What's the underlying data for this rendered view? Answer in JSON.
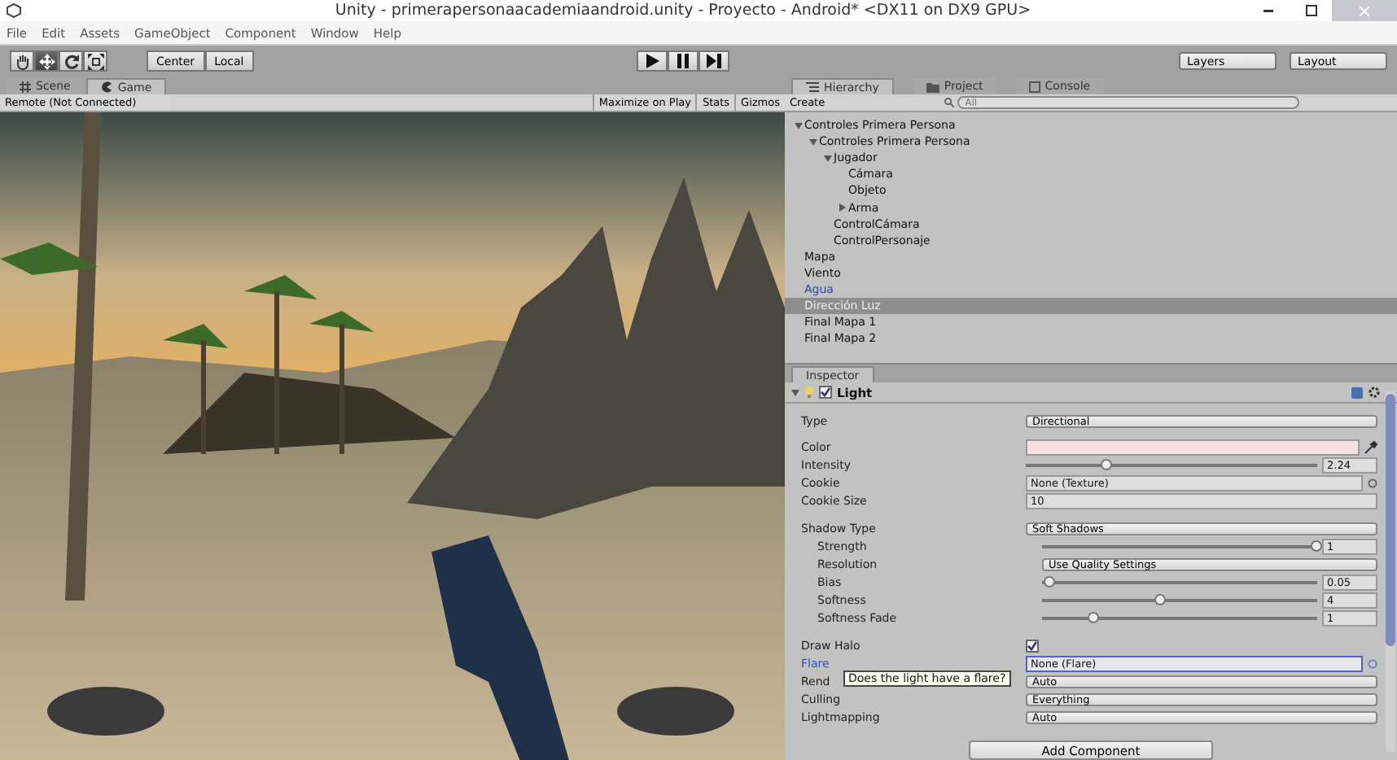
{
  "window": {
    "title": "Unity - primerapersonaacademiaandroid.unity - Proyecto - Android* <DX11 on DX9 GPU>"
  },
  "menu": [
    "File",
    "Edit",
    "Assets",
    "GameObject",
    "Component",
    "Window",
    "Help"
  ],
  "toolbar": {
    "tools": [
      {
        "kind": "hand",
        "selected": false
      },
      {
        "kind": "move",
        "selected": true
      },
      {
        "kind": "rotate",
        "selected": false
      },
      {
        "kind": "scale",
        "selected": false
      }
    ],
    "pivot": [
      "Center",
      "Local"
    ],
    "playback": [
      {
        "kind": "play"
      },
      {
        "kind": "pause"
      },
      {
        "kind": "step"
      }
    ],
    "dropdowns": [
      "Layers",
      "Layout"
    ]
  },
  "view_tabs": [
    {
      "label": "Scene",
      "kind": "scene",
      "selected": false
    },
    {
      "label": "Game",
      "kind": "game",
      "selected": true
    }
  ],
  "game_bar": {
    "remote": "Remote (Not Connected)",
    "buttons": [
      "Maximize on Play",
      "Stats",
      "Gizmos"
    ]
  },
  "panel_tabs": [
    {
      "label": "Hierarchy",
      "kind": "hierarchy",
      "selected": true
    },
    {
      "label": "Project",
      "kind": "project",
      "selected": false
    },
    {
      "label": "Console",
      "kind": "console",
      "selected": false
    }
  ],
  "hierarchy": {
    "create": "Create",
    "search": {
      "placeholder": "All"
    },
    "items": [
      {
        "label": "Controles Primera Persona",
        "expanded": true,
        "selected": false,
        "prefab": false,
        "children": [
          {
            "label": "Controles Primera Persona",
            "expanded": true,
            "selected": false,
            "prefab": false,
            "children": [
              {
                "label": "Jugador",
                "expanded": true,
                "selected": false,
                "prefab": false,
                "children": [
                  {
                    "label": "Cámara",
                    "selected": false,
                    "prefab": false
                  },
                  {
                    "label": "Objeto",
                    "selected": false,
                    "prefab": false
                  },
                  {
                    "label": "Arma",
                    "expanded": false,
                    "selected": false,
                    "prefab": false
                  }
                ]
              },
              {
                "label": "ControlCámara",
                "selected": false,
                "prefab": false
              },
              {
                "label": "ControlPersonaje",
                "selected": false,
                "prefab": false
              }
            ]
          }
        ]
      },
      {
        "label": "Mapa",
        "selected": false,
        "prefab": false
      },
      {
        "label": "Viento",
        "selected": false,
        "prefab": false
      },
      {
        "label": "Agua",
        "selected": false,
        "prefab": true
      },
      {
        "label": "Dirección Luz",
        "selected": true,
        "prefab": false
      },
      {
        "label": "Final Mapa 1",
        "selected": false,
        "prefab": false
      },
      {
        "label": "Final Mapa 2",
        "selected": false,
        "prefab": false
      }
    ]
  },
  "inspector": {
    "tab": "Inspector",
    "component": {
      "name": "Light",
      "enabled": true,
      "expanded": true
    },
    "groups": [
      [
        {
          "label": "Type",
          "kind": "dropdown",
          "value": "Directional"
        }
      ],
      [
        {
          "label": "Color",
          "kind": "color",
          "color": "#f8e0e0"
        },
        {
          "label": "Intensity",
          "kind": "slider",
          "level": 0.28,
          "value": "2.24"
        },
        {
          "label": "Cookie",
          "kind": "object",
          "value": "None (Texture)",
          "focused": false
        },
        {
          "label": "Cookie Size",
          "kind": "text",
          "value": "10"
        }
      ],
      [
        {
          "label": "Shadow Type",
          "kind": "dropdown",
          "value": "Soft Shadows",
          "children": [
            {
              "label": "Strength",
              "kind": "slider",
              "level": 1.0,
              "value": "1"
            },
            {
              "label": "Resolution",
              "kind": "dropdown",
              "value": "Use Quality Settings"
            },
            {
              "label": "Bias",
              "kind": "slider",
              "level": 0.03,
              "value": "0.05"
            },
            {
              "label": "Softness",
              "kind": "slider",
              "level": 0.43,
              "value": "4"
            },
            {
              "label": "Softness Fade",
              "kind": "slider",
              "level": 0.19,
              "value": "1"
            }
          ]
        }
      ],
      [
        {
          "label": "Draw Halo",
          "kind": "checkbox",
          "checked": true
        },
        {
          "label": "Flare",
          "kind": "object",
          "value": "None (Flare)",
          "focused": true
        },
        {
          "label": "Rend",
          "kind": "dropdown",
          "value": "Auto"
        },
        {
          "label": "Culling",
          "kind": "dropdown",
          "value": "Everything"
        },
        {
          "label": "Lightmapping",
          "kind": "dropdown",
          "value": "Auto"
        }
      ]
    ],
    "tooltip": "Does the light have a flare?",
    "add_button": "Add Component"
  }
}
